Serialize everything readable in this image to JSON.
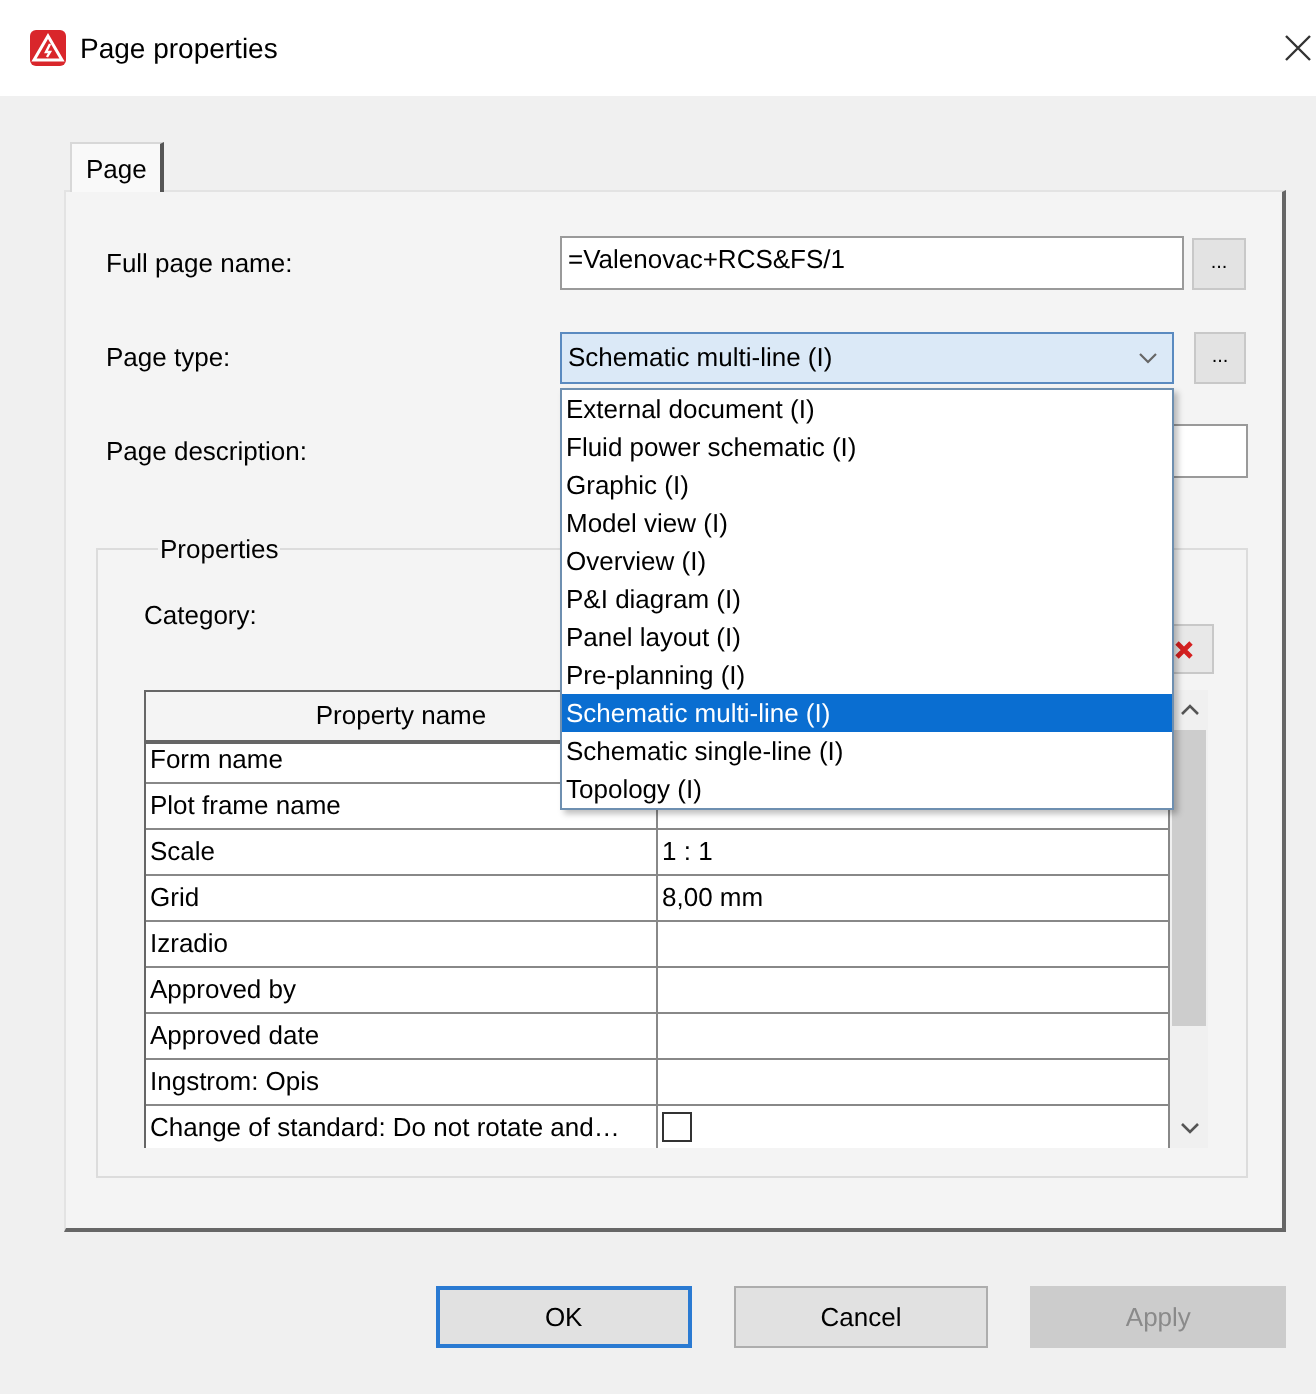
{
  "window": {
    "title": "Page properties"
  },
  "tabs": [
    {
      "label": "Page",
      "selected": true
    }
  ],
  "fields": [
    {
      "kind": "text",
      "label": "Full page name:",
      "value": "=Valenovac+RCS&FS/1",
      "button": "..."
    },
    {
      "kind": "combo",
      "label": "Page type:",
      "value": "Schematic multi-line (I)",
      "button": "...",
      "expanded": true,
      "options": [
        {
          "label": "External document (I)",
          "selected": false
        },
        {
          "label": "Fluid power schematic (I)",
          "selected": false
        },
        {
          "label": "Graphic (I)",
          "selected": false
        },
        {
          "label": "Model view (I)",
          "selected": false
        },
        {
          "label": "Overview (I)",
          "selected": false
        },
        {
          "label": "P&I diagram (I)",
          "selected": false
        },
        {
          "label": "Panel layout (I)",
          "selected": false
        },
        {
          "label": "Pre-planning  (I)",
          "selected": false
        },
        {
          "label": "Schematic multi-line (I)",
          "selected": true
        },
        {
          "label": "Schematic single-line (I)",
          "selected": false
        },
        {
          "label": "Topology (I)",
          "selected": false
        }
      ]
    },
    {
      "kind": "text",
      "label": "Page description:"
    }
  ],
  "properties": {
    "title": "Properties",
    "category_label": "Category:",
    "table": {
      "columns": [
        "Property name"
      ],
      "rows": [
        {
          "kind": "text",
          "name": "Form name"
        },
        {
          "kind": "text",
          "name": "Plot frame name"
        },
        {
          "kind": "text",
          "name": "Scale",
          "value": "1 : 1"
        },
        {
          "kind": "text",
          "name": "Grid",
          "value": "8,00 mm"
        },
        {
          "kind": "text",
          "name": "Izradio"
        },
        {
          "kind": "text",
          "name": "Approved by"
        },
        {
          "kind": "text",
          "name": "Approved date"
        },
        {
          "kind": "text",
          "name": "Ingstrom: Opis"
        },
        {
          "kind": "checkbox",
          "name": "Change of standard: Do not rotate and…",
          "checked": false
        }
      ]
    }
  },
  "buttons": [
    {
      "label": "OK",
      "default": true,
      "disabled": false
    },
    {
      "label": "Cancel",
      "default": false,
      "disabled": false
    },
    {
      "label": "Apply",
      "default": false,
      "disabled": true
    }
  ]
}
